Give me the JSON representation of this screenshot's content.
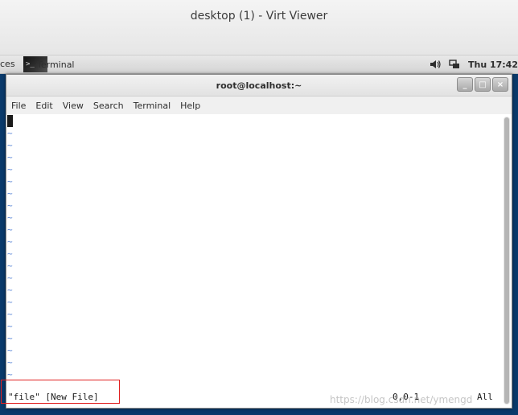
{
  "outer_window": {
    "title": "desktop (1) - Virt Viewer"
  },
  "top_panel": {
    "activities_label": "ces",
    "task_label": "Terminal",
    "task_icon_text": ">_",
    "clock": "Thu 17:42"
  },
  "terminal_window": {
    "title": "root@localhost:~",
    "controls": {
      "minimize": "_",
      "maximize": "□",
      "close": "×"
    },
    "menu": [
      "File",
      "Edit",
      "View",
      "Search",
      "Terminal",
      "Help"
    ],
    "tilde": "~",
    "status": {
      "file": "\"file\" [New File]",
      "position": "0,0-1",
      "scroll": "All"
    }
  },
  "watermark": "https://blog.csdn.net/ymengd"
}
